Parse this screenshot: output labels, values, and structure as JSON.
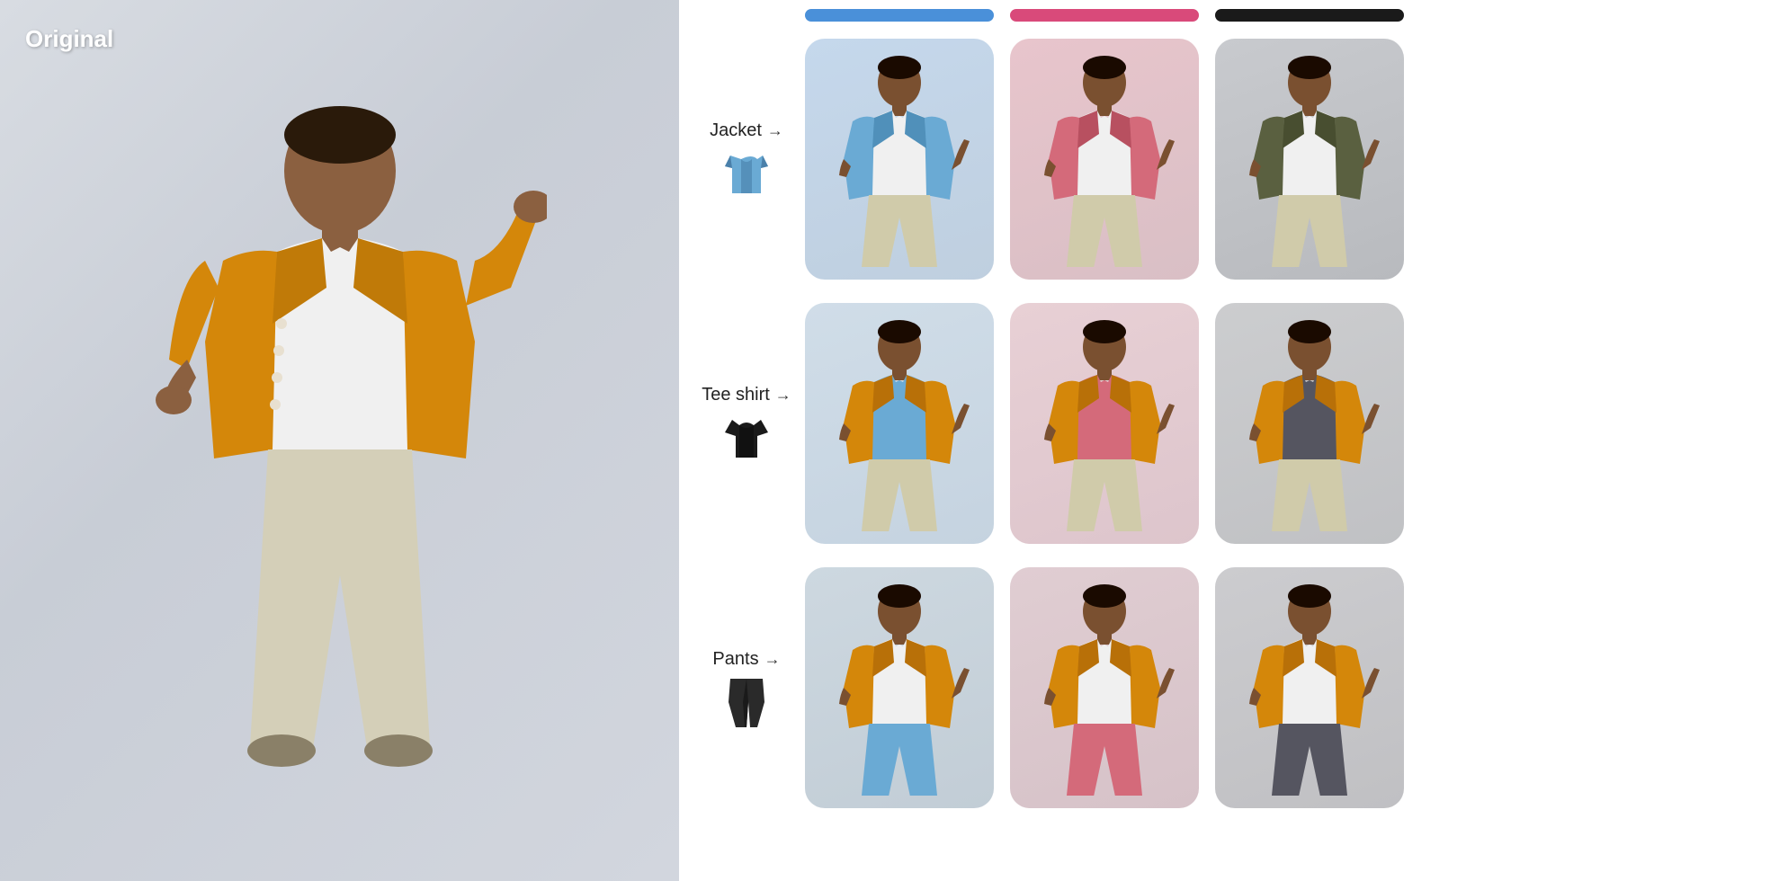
{
  "left": {
    "label": "Original"
  },
  "colors": {
    "blue_bar": "#4a90d9",
    "pink_bar": "#d94a7a",
    "black_bar": "#1a1a1a"
  },
  "rows": [
    {
      "id": "jacket",
      "label": "Jacket",
      "arrow": "→",
      "icon_type": "jacket",
      "variants": [
        {
          "id": "jacket-blue",
          "color_class": "jacket-blue",
          "jacket_color": "#6aaad4",
          "shirt_color": "#f0f0f0",
          "pants_color": "#d4cfbf"
        },
        {
          "id": "jacket-pink",
          "color_class": "jacket-pink",
          "jacket_color": "#d46a7a",
          "shirt_color": "#f0f0f0",
          "pants_color": "#d4cfbf"
        },
        {
          "id": "jacket-dark",
          "color_class": "jacket-dark",
          "jacket_color": "#5a6040",
          "shirt_color": "#f0f0f0",
          "pants_color": "#d4cfbf"
        }
      ]
    },
    {
      "id": "tee-shirt",
      "label": "Tee shirt",
      "arrow": "→",
      "icon_type": "tee",
      "variants": [
        {
          "id": "tee-blue",
          "color_class": "tee-blue",
          "jacket_color": "#d4a030",
          "shirt_color": "#6aaad4",
          "pants_color": "#d4cfbf"
        },
        {
          "id": "tee-pink",
          "color_class": "tee-pink",
          "jacket_color": "#d4a030",
          "shirt_color": "#d46a7a",
          "pants_color": "#d4cfbf"
        },
        {
          "id": "tee-dark",
          "color_class": "tee-dark",
          "jacket_color": "#d4a030",
          "shirt_color": "#555560",
          "pants_color": "#d4cfbf"
        }
      ]
    },
    {
      "id": "pants",
      "label": "Pants",
      "arrow": "→",
      "icon_type": "pants",
      "variants": [
        {
          "id": "pants-blue",
          "color_class": "pants-blue",
          "jacket_color": "#d4a030",
          "shirt_color": "#f0f0f0",
          "pants_color": "#6aaad4"
        },
        {
          "id": "pants-pink",
          "color_class": "pants-pink",
          "jacket_color": "#d4a030",
          "shirt_color": "#f0f0f0",
          "pants_color": "#d46a7a"
        },
        {
          "id": "pants-dark",
          "color_class": "pants-dark",
          "jacket_color": "#d4a030",
          "shirt_color": "#f0f0f0",
          "pants_color": "#555560"
        }
      ]
    }
  ]
}
